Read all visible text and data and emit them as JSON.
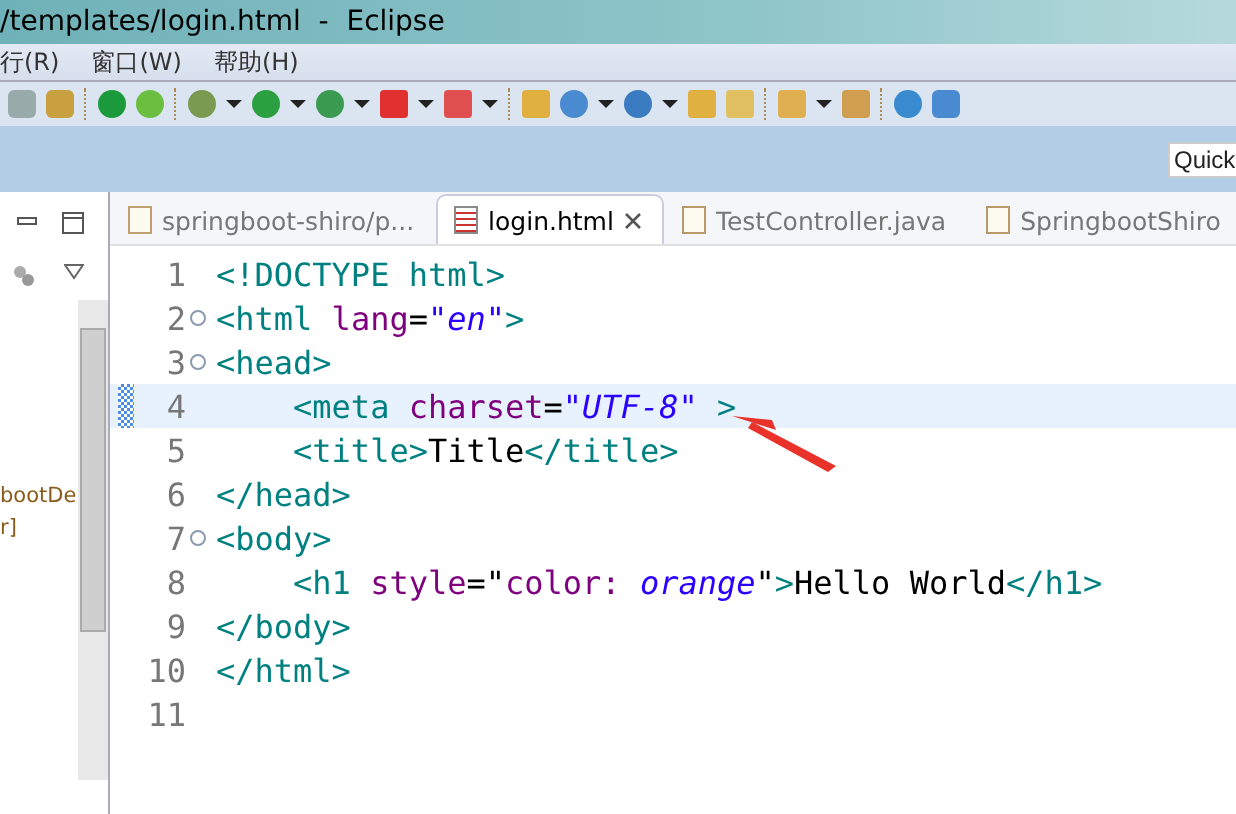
{
  "window": {
    "title": "/templates/login.html  -  Eclipse"
  },
  "menu": [
    "行(R)",
    "窗口(W)",
    "帮助(H)"
  ],
  "quick_access": {
    "placeholder": "Quick"
  },
  "left_panel": {
    "items": [
      "bootDe",
      "r]"
    ]
  },
  "tabs": [
    {
      "label": "springboot-shiro/p...",
      "selected": false,
      "kind": "maven"
    },
    {
      "label": "login.html",
      "selected": true,
      "kind": "html"
    },
    {
      "label": "TestController.java",
      "selected": false,
      "kind": "java"
    },
    {
      "label": "SpringbootShiro",
      "selected": false,
      "kind": "java"
    }
  ],
  "editor": {
    "lines": [
      {
        "number": "1",
        "fold": false,
        "current": false,
        "tokens": [
          {
            "kind": "tag",
            "text": "<!DOCTYPE html>"
          }
        ]
      },
      {
        "number": "2",
        "fold": true,
        "current": false,
        "tokens": [
          {
            "kind": "tag",
            "text": "<html"
          },
          {
            "kind": "attr",
            "text": " lang"
          },
          {
            "kind": "plain",
            "text": "="
          },
          {
            "kind": "value",
            "text": "\"en\""
          },
          {
            "kind": "tag",
            "text": ">"
          }
        ]
      },
      {
        "number": "3",
        "fold": true,
        "current": false,
        "tokens": [
          {
            "kind": "tag",
            "text": "<head>"
          }
        ]
      },
      {
        "number": "4",
        "fold": false,
        "current": true,
        "tokens": [
          {
            "kind": "tag",
            "text": "    <meta"
          },
          {
            "kind": "attr",
            "text": " charset"
          },
          {
            "kind": "plain",
            "text": "="
          },
          {
            "kind": "value",
            "text": "\"UTF-8\""
          },
          {
            "kind": "tag",
            "text": " >"
          }
        ]
      },
      {
        "number": "5",
        "fold": false,
        "current": false,
        "tokens": [
          {
            "kind": "tag",
            "text": "    <title>"
          },
          {
            "kind": "text",
            "text": "Title"
          },
          {
            "kind": "tag",
            "text": "</title>"
          }
        ]
      },
      {
        "number": "6",
        "fold": false,
        "current": false,
        "tokens": [
          {
            "kind": "tag",
            "text": "</head>"
          }
        ]
      },
      {
        "number": "7",
        "fold": true,
        "current": false,
        "tokens": [
          {
            "kind": "tag",
            "text": "<body>"
          }
        ]
      },
      {
        "number": "8",
        "fold": false,
        "current": false,
        "tokens": [
          {
            "kind": "tag",
            "text": "    <h1"
          },
          {
            "kind": "attr",
            "text": " style"
          },
          {
            "kind": "plain",
            "text": "=\""
          },
          {
            "kind": "attr",
            "text": "color: "
          },
          {
            "kind": "value",
            "text": "orange"
          },
          {
            "kind": "plain",
            "text": "\""
          },
          {
            "kind": "tag",
            "text": ">"
          },
          {
            "kind": "text",
            "text": "Hello World"
          },
          {
            "kind": "tag",
            "text": "</h1>"
          }
        ]
      },
      {
        "number": "9",
        "fold": false,
        "current": false,
        "tokens": [
          {
            "kind": "tag",
            "text": "</body>"
          }
        ]
      },
      {
        "number": "10",
        "fold": false,
        "current": false,
        "tokens": [
          {
            "kind": "tag",
            "text": "</html>"
          }
        ]
      },
      {
        "number": "11",
        "fold": false,
        "current": false
      }
    ]
  }
}
